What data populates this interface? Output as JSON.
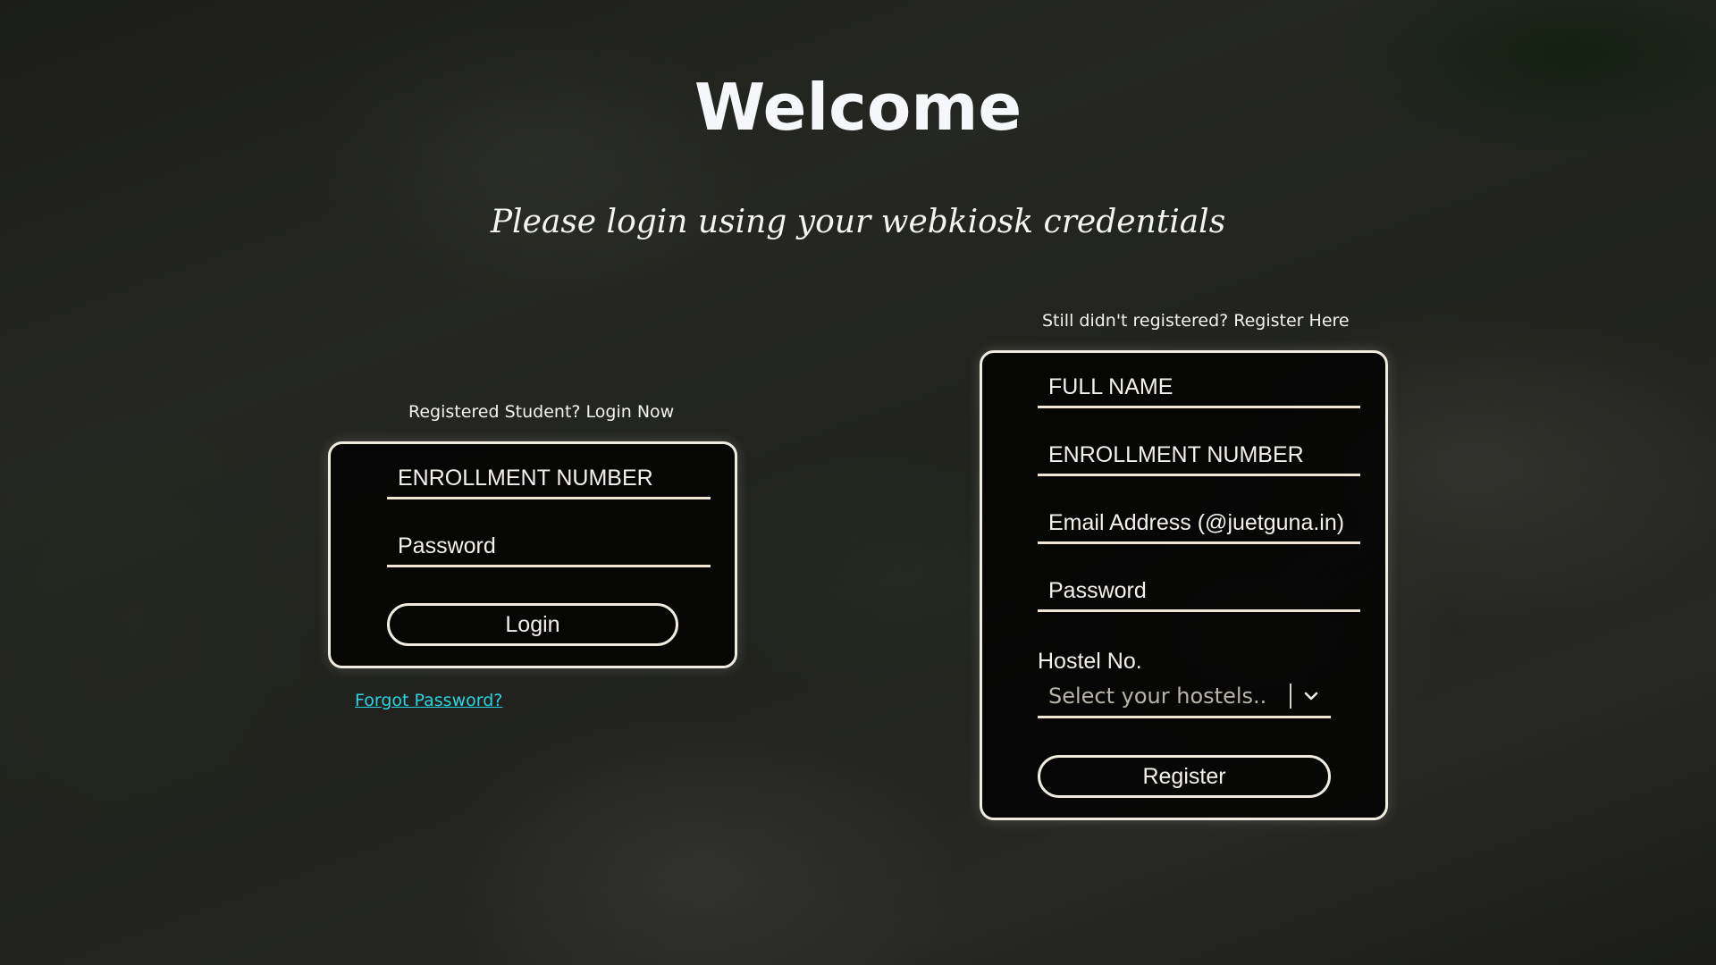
{
  "header": {
    "title": "Welcome",
    "subtitle": "Please login using your webkiosk credentials"
  },
  "login": {
    "caption": "Registered Student? Login Now",
    "enrollment_placeholder": "ENROLLMENT NUMBER",
    "password_placeholder": "Password",
    "button_label": "Login",
    "forgot_link": "Forgot Password?"
  },
  "register": {
    "caption": "Still didn't registered? Register Here",
    "fullname_placeholder": "FULL NAME",
    "enrollment_placeholder": "ENROLLMENT NUMBER",
    "email_placeholder": "Email Address (@juetguna.in)",
    "password_placeholder": "Password",
    "hostel_label": "Hostel No.",
    "hostel_select_placeholder": "Select your hostels..",
    "button_label": "Register"
  },
  "icons": {
    "dropdown": "chevron-down-icon"
  },
  "colors": {
    "accent_border": "#f1ece2",
    "link": "#2ad3e0",
    "card_background": "#000000"
  }
}
